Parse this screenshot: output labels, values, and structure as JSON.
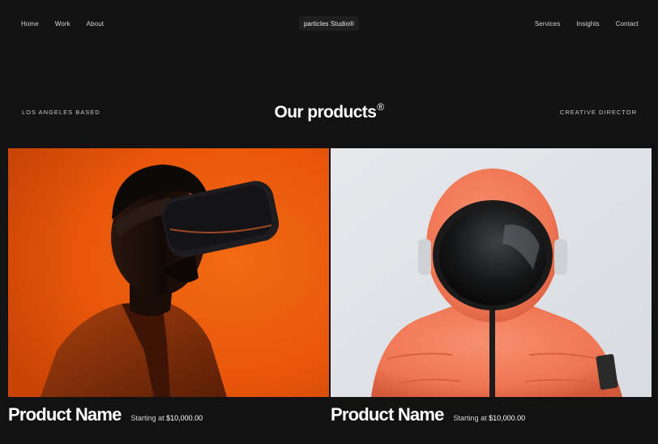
{
  "nav": {
    "left": [
      "Home",
      "Work",
      "About"
    ],
    "right": [
      "Services",
      "Insights",
      "Contact"
    ],
    "logo": "particles Studio®"
  },
  "hero": {
    "left_tagline": "LOS ANGELES BASED",
    "title": "Our products",
    "title_mark": "®",
    "right_tagline": "CREATIVE DIRECTOR"
  },
  "products": [
    {
      "name": "Product Name",
      "price_prefix": "Starting at",
      "price": "$10,000.00",
      "image": "person-wearing-vr-headset-orange-background"
    },
    {
      "name": "Product Name",
      "price_prefix": "Starting at",
      "price": "$10,000.00",
      "image": "person-in-orange-spacesuit-and-helmet"
    }
  ],
  "colors": {
    "background": "#121212",
    "text": "#ffffff",
    "card1_bg": "#e8580c",
    "card2_bg": "#e4e6ea",
    "suit": "#f27a55"
  }
}
